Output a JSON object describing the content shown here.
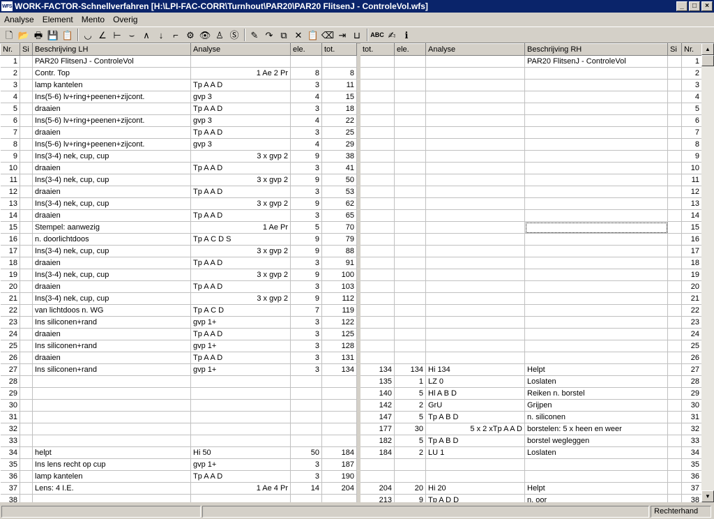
{
  "window": {
    "app_icon": "WFS",
    "title": "WORK-FACTOR-Schnellverfahren    [H:\\LPI-FAC-CORR\\Turnhout\\PAR20\\PAR20 FlitsenJ - ControleVol.wfs]",
    "minimize": "_",
    "maximize": "□",
    "close": "×"
  },
  "menu": [
    "Analyse",
    "Element",
    "Mento",
    "Overig"
  ],
  "toolbar": {
    "groups": [
      [
        {
          "name": "new-file-icon",
          "glyph": "🗋"
        },
        {
          "name": "open-folder-icon",
          "glyph": "📂"
        },
        {
          "name": "print-icon",
          "glyph": "🖶"
        },
        {
          "name": "save-icon",
          "glyph": "💾"
        },
        {
          "name": "report-icon",
          "glyph": "📋"
        }
      ],
      [
        {
          "name": "arc-symbol-icon",
          "glyph": "◡"
        },
        {
          "name": "angle-symbol-icon",
          "glyph": "∠"
        },
        {
          "name": "tee-symbol-icon",
          "glyph": "⊢"
        },
        {
          "name": "cup-symbol-icon",
          "glyph": "⌣"
        },
        {
          "name": "wedge-symbol-icon",
          "glyph": "∧"
        },
        {
          "name": "down-arrow-icon",
          "glyph": "↓"
        },
        {
          "name": "corner-symbol-icon",
          "glyph": "⌐"
        },
        {
          "name": "gear-icon",
          "glyph": "⚙"
        },
        {
          "name": "eye-icon",
          "glyph": "👁"
        },
        {
          "name": "person-icon",
          "glyph": "♙"
        },
        {
          "name": "s-circle-icon",
          "glyph": "Ⓢ"
        }
      ],
      [
        {
          "name": "edit-icon",
          "glyph": "✎"
        },
        {
          "name": "redo-icon",
          "glyph": "↷"
        },
        {
          "name": "copy-icon",
          "glyph": "⧉"
        },
        {
          "name": "delete-icon",
          "glyph": "✕"
        },
        {
          "name": "paste-icon",
          "glyph": "📋"
        },
        {
          "name": "clear-icon",
          "glyph": "⌫"
        },
        {
          "name": "indent-icon",
          "glyph": "⇥"
        },
        {
          "name": "magnet-icon",
          "glyph": "⊔"
        }
      ],
      [
        {
          "name": "spellcheck-icon",
          "glyph": "ABC",
          "small": true
        },
        {
          "name": "format-icon",
          "glyph": "✍"
        },
        {
          "name": "info-icon",
          "glyph": "ℹ"
        }
      ]
    ]
  },
  "grid": {
    "left_headers": {
      "nr": "Nr.",
      "si": "Si",
      "desc": "Beschrijving LH",
      "analyse": "Analyse",
      "ele": "ele.",
      "tot": "tot."
    },
    "right_headers": {
      "tot": "tot.",
      "ele": "ele.",
      "analyse": "Analyse",
      "desc": "Beschrijving RH",
      "si": "Si",
      "nr": "Nr."
    },
    "rows": [
      {
        "nr": "1",
        "l_desc": "PAR20 FlitsenJ - ControleVol",
        "l_an": "",
        "l_an_r": "",
        "l_ele": "",
        "l_tot": "",
        "r_tot": "",
        "r_ele": "",
        "r_an": "",
        "r_an_r": "",
        "r_desc": "PAR20 FlitsenJ - ControleVol"
      },
      {
        "nr": "2",
        "l_desc": "Contr. Top",
        "l_an": "",
        "l_an_r": "1 Ae 2 Pr",
        "l_ele": "8",
        "l_tot": "8",
        "r_tot": "",
        "r_ele": "",
        "r_an": "",
        "r_an_r": "",
        "r_desc": ""
      },
      {
        "nr": "3",
        "l_desc": "lamp kantelen",
        "l_an": "Tp A A D",
        "l_an_r": "",
        "l_ele": "3",
        "l_tot": "11",
        "r_tot": "",
        "r_ele": "",
        "r_an": "",
        "r_an_r": "",
        "r_desc": ""
      },
      {
        "nr": "4",
        "l_desc": "Ins(5-6) lv+ring+peenen+zijcont.",
        "l_an": "gvp 3",
        "l_an_r": "",
        "l_ele": "4",
        "l_tot": "15",
        "r_tot": "",
        "r_ele": "",
        "r_an": "",
        "r_an_r": "",
        "r_desc": ""
      },
      {
        "nr": "5",
        "l_desc": "draaien",
        "l_an": "Tp A A D",
        "l_an_r": "",
        "l_ele": "3",
        "l_tot": "18",
        "r_tot": "",
        "r_ele": "",
        "r_an": "",
        "r_an_r": "",
        "r_desc": ""
      },
      {
        "nr": "6",
        "l_desc": "Ins(5-6) lv+ring+peenen+zijcont.",
        "l_an": "gvp 3",
        "l_an_r": "",
        "l_ele": "4",
        "l_tot": "22",
        "r_tot": "",
        "r_ele": "",
        "r_an": "",
        "r_an_r": "",
        "r_desc": ""
      },
      {
        "nr": "7",
        "l_desc": "draaien",
        "l_an": "Tp A A D",
        "l_an_r": "",
        "l_ele": "3",
        "l_tot": "25",
        "r_tot": "",
        "r_ele": "",
        "r_an": "",
        "r_an_r": "",
        "r_desc": ""
      },
      {
        "nr": "8",
        "l_desc": "Ins(5-6) lv+ring+peenen+zijcont.",
        "l_an": "gvp 3",
        "l_an_r": "",
        "l_ele": "4",
        "l_tot": "29",
        "r_tot": "",
        "r_ele": "",
        "r_an": "",
        "r_an_r": "",
        "r_desc": ""
      },
      {
        "nr": "9",
        "l_desc": "Ins(3-4) nek, cup, cup",
        "l_an": "",
        "l_an_r": "3 x gvp 2",
        "l_ele": "9",
        "l_tot": "38",
        "r_tot": "",
        "r_ele": "",
        "r_an": "",
        "r_an_r": "",
        "r_desc": ""
      },
      {
        "nr": "10",
        "l_desc": "draaien",
        "l_an": "Tp A A D",
        "l_an_r": "",
        "l_ele": "3",
        "l_tot": "41",
        "r_tot": "",
        "r_ele": "",
        "r_an": "",
        "r_an_r": "",
        "r_desc": ""
      },
      {
        "nr": "11",
        "l_desc": "Ins(3-4) nek, cup, cup",
        "l_an": "",
        "l_an_r": "3 x gvp 2",
        "l_ele": "9",
        "l_tot": "50",
        "r_tot": "",
        "r_ele": "",
        "r_an": "",
        "r_an_r": "",
        "r_desc": ""
      },
      {
        "nr": "12",
        "l_desc": "draaien",
        "l_an": "Tp A A D",
        "l_an_r": "",
        "l_ele": "3",
        "l_tot": "53",
        "r_tot": "",
        "r_ele": "",
        "r_an": "",
        "r_an_r": "",
        "r_desc": ""
      },
      {
        "nr": "13",
        "l_desc": "Ins(3-4) nek, cup, cup",
        "l_an": "",
        "l_an_r": "3 x gvp 2",
        "l_ele": "9",
        "l_tot": "62",
        "r_tot": "",
        "r_ele": "",
        "r_an": "",
        "r_an_r": "",
        "r_desc": ""
      },
      {
        "nr": "14",
        "l_desc": "draaien",
        "l_an": "Tp A A D",
        "l_an_r": "",
        "l_ele": "3",
        "l_tot": "65",
        "r_tot": "",
        "r_ele": "",
        "r_an": "",
        "r_an_r": "",
        "r_desc": ""
      },
      {
        "nr": "15",
        "l_desc": "Stempel: aanwezig",
        "l_an": "",
        "l_an_r": "1 Ae Pr",
        "l_ele": "5",
        "l_tot": "70",
        "r_tot": "",
        "r_ele": "",
        "r_an": "",
        "r_an_r": "",
        "r_desc": "",
        "focus": true
      },
      {
        "nr": "16",
        "l_desc": "n. doorlichtdoos",
        "l_an": "Tp A C D S",
        "l_an_r": "",
        "l_ele": "9",
        "l_tot": "79",
        "r_tot": "",
        "r_ele": "",
        "r_an": "",
        "r_an_r": "",
        "r_desc": ""
      },
      {
        "nr": "17",
        "l_desc": "Ins(3-4) nek, cup, cup",
        "l_an": "",
        "l_an_r": "3 x gvp 2",
        "l_ele": "9",
        "l_tot": "88",
        "r_tot": "",
        "r_ele": "",
        "r_an": "",
        "r_an_r": "",
        "r_desc": ""
      },
      {
        "nr": "18",
        "l_desc": "draaien",
        "l_an": "Tp A A D",
        "l_an_r": "",
        "l_ele": "3",
        "l_tot": "91",
        "r_tot": "",
        "r_ele": "",
        "r_an": "",
        "r_an_r": "",
        "r_desc": ""
      },
      {
        "nr": "19",
        "l_desc": "Ins(3-4) nek, cup, cup",
        "l_an": "",
        "l_an_r": "3 x gvp 2",
        "l_ele": "9",
        "l_tot": "100",
        "r_tot": "",
        "r_ele": "",
        "r_an": "",
        "r_an_r": "",
        "r_desc": ""
      },
      {
        "nr": "20",
        "l_desc": "draaien",
        "l_an": "Tp A A D",
        "l_an_r": "",
        "l_ele": "3",
        "l_tot": "103",
        "r_tot": "",
        "r_ele": "",
        "r_an": "",
        "r_an_r": "",
        "r_desc": ""
      },
      {
        "nr": "21",
        "l_desc": "Ins(3-4) nek, cup, cup",
        "l_an": "",
        "l_an_r": "3 x gvp 2",
        "l_ele": "9",
        "l_tot": "112",
        "r_tot": "",
        "r_ele": "",
        "r_an": "",
        "r_an_r": "",
        "r_desc": ""
      },
      {
        "nr": "22",
        "l_desc": "van lichtdoos n. WG",
        "l_an": "Tp A C D",
        "l_an_r": "",
        "l_ele": "7",
        "l_tot": "119",
        "r_tot": "",
        "r_ele": "",
        "r_an": "",
        "r_an_r": "",
        "r_desc": ""
      },
      {
        "nr": "23",
        "l_desc": "Ins siliconen+rand",
        "l_an": "gvp 1+",
        "l_an_r": "",
        "l_ele": "3",
        "l_tot": "122",
        "r_tot": "",
        "r_ele": "",
        "r_an": "",
        "r_an_r": "",
        "r_desc": ""
      },
      {
        "nr": "24",
        "l_desc": "draaien",
        "l_an": "Tp A A D",
        "l_an_r": "",
        "l_ele": "3",
        "l_tot": "125",
        "r_tot": "",
        "r_ele": "",
        "r_an": "",
        "r_an_r": "",
        "r_desc": ""
      },
      {
        "nr": "25",
        "l_desc": "Ins siliconen+rand",
        "l_an": "gvp 1+",
        "l_an_r": "",
        "l_ele": "3",
        "l_tot": "128",
        "r_tot": "",
        "r_ele": "",
        "r_an": "",
        "r_an_r": "",
        "r_desc": ""
      },
      {
        "nr": "26",
        "l_desc": "draaien",
        "l_an": "Tp A A D",
        "l_an_r": "",
        "l_ele": "3",
        "l_tot": "131",
        "r_tot": "",
        "r_ele": "",
        "r_an": "",
        "r_an_r": "",
        "r_desc": ""
      },
      {
        "nr": "27",
        "l_desc": "Ins siliconen+rand",
        "l_an": "gvp 1+",
        "l_an_r": "",
        "l_ele": "3",
        "l_tot": "134",
        "r_tot": "134",
        "r_ele": "134",
        "r_an": "Hi 134",
        "r_an_r": "",
        "r_desc": "Helpt"
      },
      {
        "nr": "28",
        "l_desc": "",
        "l_an": "",
        "l_an_r": "",
        "l_ele": "",
        "l_tot": "",
        "r_tot": "135",
        "r_ele": "1",
        "r_an": "LZ 0",
        "r_an_r": "",
        "r_desc": "Loslaten"
      },
      {
        "nr": "29",
        "l_desc": "",
        "l_an": "",
        "l_an_r": "",
        "l_ele": "",
        "l_tot": "",
        "r_tot": "140",
        "r_ele": "5",
        "r_an": "Hl A B D",
        "r_an_r": "",
        "r_desc": "Reiken n. borstel"
      },
      {
        "nr": "30",
        "l_desc": "",
        "l_an": "",
        "l_an_r": "",
        "l_ele": "",
        "l_tot": "",
        "r_tot": "142",
        "r_ele": "2",
        "r_an": "GrU",
        "r_an_r": "",
        "r_desc": "Grijpen"
      },
      {
        "nr": "31",
        "l_desc": "",
        "l_an": "",
        "l_an_r": "",
        "l_ele": "",
        "l_tot": "",
        "r_tot": "147",
        "r_ele": "5",
        "r_an": "Tp A B D",
        "r_an_r": "",
        "r_desc": "n. siliconen"
      },
      {
        "nr": "32",
        "l_desc": "",
        "l_an": "",
        "l_an_r": "",
        "l_ele": "",
        "l_tot": "",
        "r_tot": "177",
        "r_ele": "30",
        "r_an": "",
        "r_an_r": "5 x 2 xTp A A D",
        "r_desc": "borstelen: 5 x heen en weer"
      },
      {
        "nr": "33",
        "l_desc": "",
        "l_an": "",
        "l_an_r": "",
        "l_ele": "",
        "l_tot": "",
        "r_tot": "182",
        "r_ele": "5",
        "r_an": "Tp A B D",
        "r_an_r": "",
        "r_desc": "borstel wegleggen"
      },
      {
        "nr": "34",
        "l_desc": "helpt",
        "l_an": "Hi 50",
        "l_an_r": "",
        "l_ele": "50",
        "l_tot": "184",
        "r_tot": "184",
        "r_ele": "2",
        "r_an": "LU 1",
        "r_an_r": "",
        "r_desc": "Loslaten"
      },
      {
        "nr": "35",
        "l_desc": "Ins lens recht op cup",
        "l_an": "gvp 1+",
        "l_an_r": "",
        "l_ele": "3",
        "l_tot": "187",
        "r_tot": "",
        "r_ele": "",
        "r_an": "",
        "r_an_r": "",
        "r_desc": ""
      },
      {
        "nr": "36",
        "l_desc": "lamp kantelen",
        "l_an": "Tp A A D",
        "l_an_r": "",
        "l_ele": "3",
        "l_tot": "190",
        "r_tot": "",
        "r_ele": "",
        "r_an": "",
        "r_an_r": "",
        "r_desc": ""
      },
      {
        "nr": "37",
        "l_desc": "Lens: 4 I.E.",
        "l_an": "",
        "l_an_r": "1 Ae 4 Pr",
        "l_ele": "14",
        "l_tot": "204",
        "r_tot": "204",
        "r_ele": "20",
        "r_an": "Hi 20",
        "r_an_r": "",
        "r_desc": "Helpt"
      },
      {
        "nr": "38",
        "l_desc": "",
        "l_an": "",
        "l_an_r": "",
        "l_ele": "",
        "l_tot": "",
        "r_tot": "213",
        "r_ele": "9",
        "r_an": "Tp A D D",
        "r_an_r": "",
        "r_desc": "n. oor"
      }
    ]
  },
  "scrollbar": {
    "up": "▲",
    "down": "▼"
  },
  "status": {
    "right_panel": "Rechterhand"
  }
}
